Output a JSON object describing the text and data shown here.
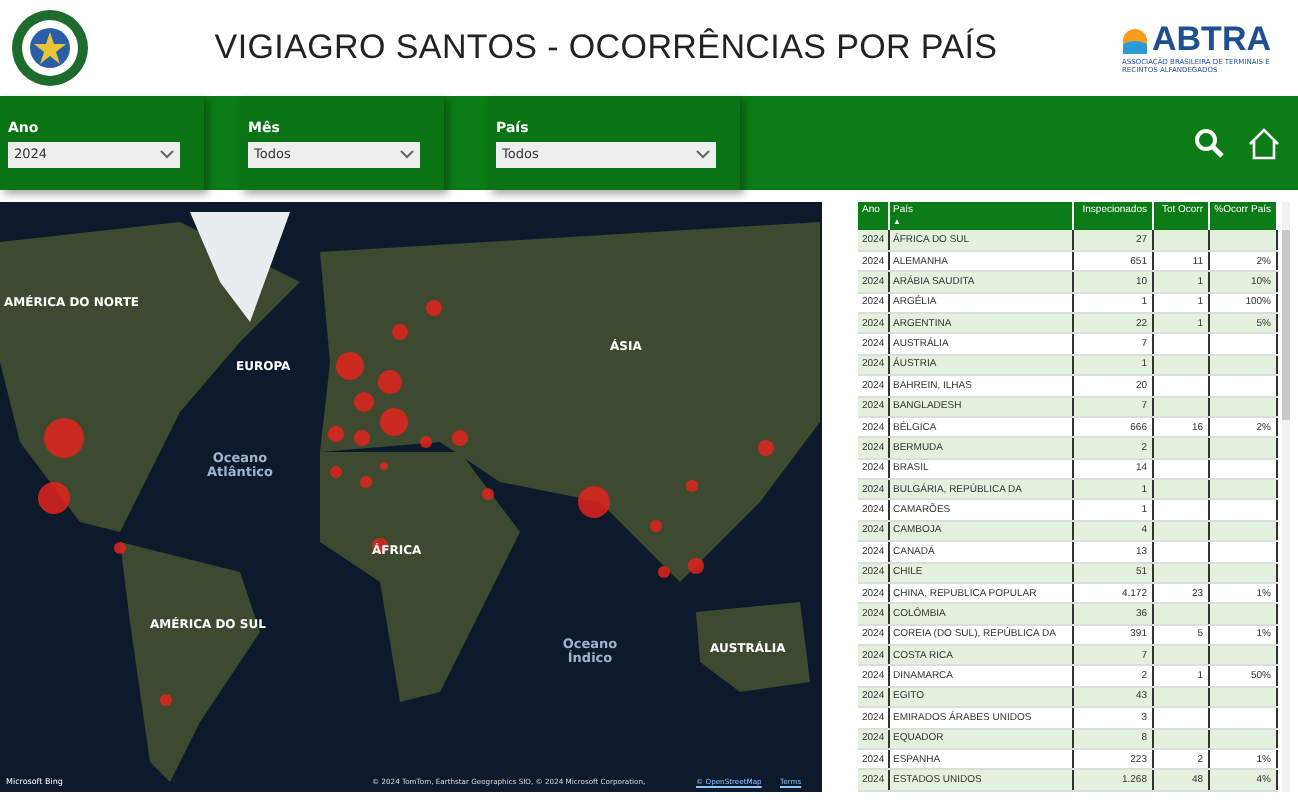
{
  "header": {
    "title": "VIGIAGRO SANTOS - OCORRÊNCIAS POR PAÍS",
    "logo": {
      "name": "ABTRA",
      "tagline": "ASSOCIAÇÃO BRASILEIRA DE TERMINAIS E RECINTOS ALFANDEGADOS"
    }
  },
  "filters": [
    {
      "label": "Ano",
      "value": "2024"
    },
    {
      "label": "Mês",
      "value": "Todos"
    },
    {
      "label": "País",
      "value": "Todos"
    }
  ],
  "map": {
    "labels": [
      {
        "text": "AMÉRICA DO NORTE",
        "kind": "continent"
      },
      {
        "text": "EUROPA",
        "kind": "continent"
      },
      {
        "text": "ÁSIA",
        "kind": "continent"
      },
      {
        "text": "Oceano Atlântico",
        "kind": "ocean"
      },
      {
        "text": "ÁFRICA",
        "kind": "continent"
      },
      {
        "text": "AMÉRICA DO SUL",
        "kind": "continent"
      },
      {
        "text": "Oceano Índico",
        "kind": "ocean"
      },
      {
        "text": "AUSTRÁLIA",
        "kind": "continent"
      }
    ],
    "brand": "Microsoft Bing",
    "attribution": "© 2024 TomTom, Earthstar Geographics SIO, © 2024 Microsoft Corporation,",
    "osm": "© OpenStreetMap",
    "terms": "Terms"
  },
  "table": {
    "columns": [
      "Ano",
      "País",
      "Inspecionados",
      "Tot Ocorr",
      "%Ocorr País"
    ],
    "sort_mark": "▲",
    "rows": [
      [
        "2024",
        "ÁFRICA DO SUL",
        "27",
        "",
        ""
      ],
      [
        "2024",
        "ALEMANHA",
        "651",
        "11",
        "2%"
      ],
      [
        "2024",
        "ARÁBIA SAUDITA",
        "10",
        "1",
        "10%"
      ],
      [
        "2024",
        "ARGÉLIA",
        "1",
        "1",
        "100%"
      ],
      [
        "2024",
        "ARGENTINA",
        "22",
        "1",
        "5%"
      ],
      [
        "2024",
        "AUSTRÁLIA",
        "7",
        "",
        ""
      ],
      [
        "2024",
        "ÁUSTRIA",
        "1",
        "",
        ""
      ],
      [
        "2024",
        "BAHREIN, ILHAS",
        "20",
        "",
        ""
      ],
      [
        "2024",
        "BANGLADESH",
        "7",
        "",
        ""
      ],
      [
        "2024",
        "BÉLGICA",
        "666",
        "16",
        "2%"
      ],
      [
        "2024",
        "BERMUDA",
        "2",
        "",
        ""
      ],
      [
        "2024",
        "BRASIL",
        "14",
        "",
        ""
      ],
      [
        "2024",
        "BULGÁRIA, REPÚBLICA DA",
        "1",
        "",
        ""
      ],
      [
        "2024",
        "CAMARÕES",
        "1",
        "",
        ""
      ],
      [
        "2024",
        "CAMBOJA",
        "4",
        "",
        ""
      ],
      [
        "2024",
        "CANADÁ",
        "13",
        "",
        ""
      ],
      [
        "2024",
        "CHILE",
        "51",
        "",
        ""
      ],
      [
        "2024",
        "CHINA, REPUBLICA POPULAR",
        "4.172",
        "23",
        "1%"
      ],
      [
        "2024",
        "COLÔMBIA",
        "36",
        "",
        ""
      ],
      [
        "2024",
        "COREIA (DO SUL), REPÚBLICA DA",
        "391",
        "5",
        "1%"
      ],
      [
        "2024",
        "COSTA RICA",
        "7",
        "",
        ""
      ],
      [
        "2024",
        "DINAMARCA",
        "2",
        "1",
        "50%"
      ],
      [
        "2024",
        "EGITO",
        "43",
        "",
        ""
      ],
      [
        "2024",
        "EMIRADOS ÁRABES UNIDOS",
        "3",
        "",
        ""
      ],
      [
        "2024",
        "EQUADOR",
        "8",
        "",
        ""
      ],
      [
        "2024",
        "ESPANHA",
        "223",
        "2",
        "1%"
      ],
      [
        "2024",
        "ESTADOS UNIDOS",
        "1.268",
        "48",
        "4%"
      ]
    ]
  }
}
